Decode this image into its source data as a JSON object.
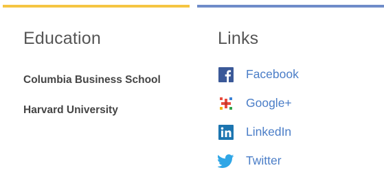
{
  "education": {
    "heading": "Education",
    "items": [
      "Columbia Business School",
      "Harvard University"
    ]
  },
  "links": {
    "heading": "Links",
    "items": [
      {
        "label": "Facebook",
        "icon": "facebook-icon"
      },
      {
        "label": "Google+",
        "icon": "google-plus-icon"
      },
      {
        "label": "LinkedIn",
        "icon": "linkedin-icon"
      },
      {
        "label": "Twitter",
        "icon": "twitter-icon"
      }
    ]
  },
  "colors": {
    "accent_left": "#f5c542",
    "accent_right": "#6f8cc9",
    "link": "#4a7dc7",
    "facebook": "#3b5998",
    "linkedin": "#1c75b0",
    "twitter": "#2fa6e6"
  }
}
